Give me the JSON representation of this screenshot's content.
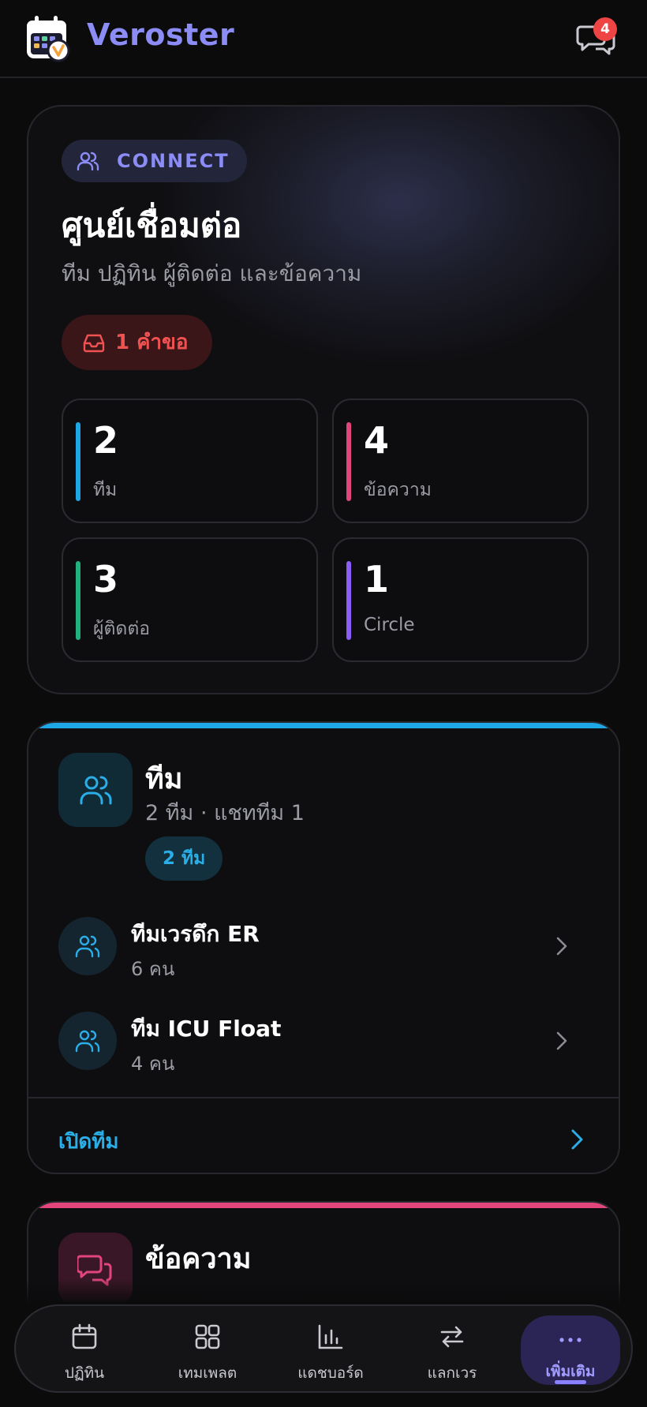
{
  "header": {
    "app_title": "Veroster",
    "notification_count": "4"
  },
  "hero": {
    "tag": "CONNECT",
    "title": "ศูนย์เชื่อมต่อ",
    "subtitle": "ทีม ปฏิทิน ผู้ติดต่อ และข้อความ",
    "request_pill": "1 คำขอ",
    "stats": [
      {
        "value": "2",
        "label": "ทีม",
        "color": "#1ea6e6"
      },
      {
        "value": "4",
        "label": "ข้อความ",
        "color": "#e0457b"
      },
      {
        "value": "3",
        "label": "ผู้ติดต่อ",
        "color": "#22b07d"
      },
      {
        "value": "1",
        "label": "Circle",
        "color": "#8b5cf6"
      }
    ]
  },
  "teams": {
    "title": "ทีม",
    "subtitle": "2 ทีม · แชททีม 1",
    "count_pill": "2 ทีม",
    "items": [
      {
        "name": "ทีมเวรดึก ER",
        "members": "6 คน"
      },
      {
        "name": "ทีม ICU Float",
        "members": "4 คน"
      }
    ],
    "open_link": "เปิดทีม",
    "accent": "#1ea6e6"
  },
  "messages": {
    "title": "ข้อความ",
    "accent": "#e0457b"
  },
  "bottom_nav": {
    "items": [
      {
        "label": "ปฏิทิน",
        "icon": "calendar-icon"
      },
      {
        "label": "เทมเพลต",
        "icon": "grid-icon"
      },
      {
        "label": "แดชบอร์ด",
        "icon": "bar-chart-icon"
      },
      {
        "label": "แลกเวร",
        "icon": "swap-icon"
      },
      {
        "label": "เพิ่มเติม",
        "icon": "more-icon"
      }
    ]
  }
}
